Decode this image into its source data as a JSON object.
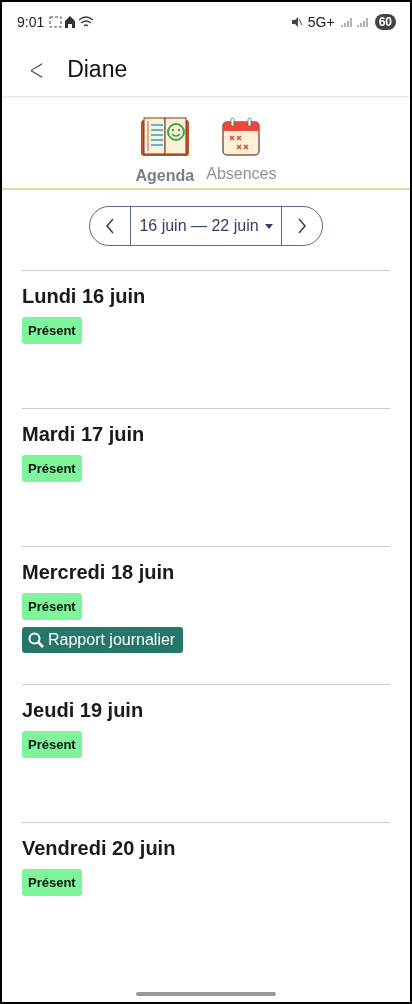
{
  "status_bar": {
    "time": "9:01",
    "network": "5G+",
    "battery": "60"
  },
  "header": {
    "back": "<",
    "title": "Diane"
  },
  "tabs": [
    {
      "label": "Agenda",
      "kind": "agenda",
      "selected": true
    },
    {
      "label": "Absences",
      "kind": "absences",
      "selected": false
    }
  ],
  "week_nav": {
    "range": "16 juin — 22 juin"
  },
  "days": [
    {
      "title": "Lundi 16 juin",
      "status": "Présent"
    },
    {
      "title": "Mardi 17 juin",
      "status": "Présent"
    },
    {
      "title": "Mercredi 18 juin",
      "status": "Présent",
      "report": "Rapport journalier"
    },
    {
      "title": "Jeudi 19 juin",
      "status": "Présent"
    },
    {
      "title": "Vendredi 20 juin",
      "status": "Présent"
    }
  ]
}
